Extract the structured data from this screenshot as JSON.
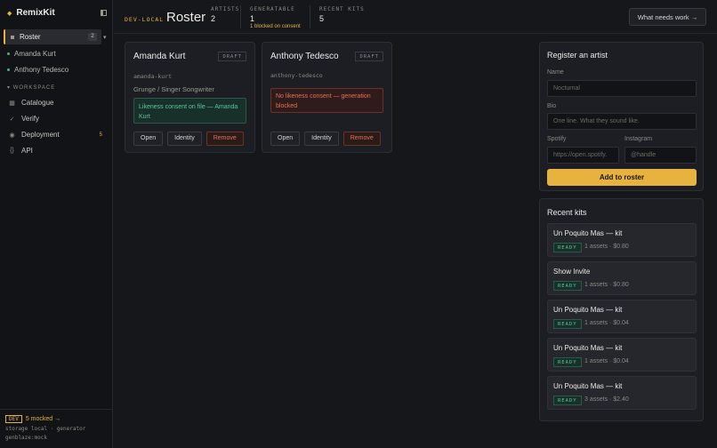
{
  "sidebar": {
    "brand": "RemixKit",
    "nav_roster": {
      "label": "Roster",
      "count": "2"
    },
    "artists": [
      "Amanda Kurt",
      "Anthony Tedesco"
    ],
    "workspace_title": "WORKSPACE",
    "workspace_items": [
      {
        "label": "Catalogue",
        "icon": "catalogue-icon",
        "badge": ""
      },
      {
        "label": "Verify",
        "icon": "check-icon",
        "badge": ""
      },
      {
        "label": "Deployment",
        "icon": "deploy-icon",
        "badge": "5"
      },
      {
        "label": "API",
        "icon": "braces-icon",
        "badge": ""
      }
    ],
    "footer": {
      "dev_badge": "DEV",
      "mocked": "5 mocked →",
      "storage": "storage local · generator",
      "gen": "genblaze:mock"
    }
  },
  "header": {
    "env": "DEV-LOCAL",
    "title": "Roster",
    "stats": [
      {
        "label": "ARTISTS",
        "value": "2",
        "note": ""
      },
      {
        "label": "GENERATABLE",
        "value": "1",
        "note": "1 blocked on consent"
      },
      {
        "label": "RECENT KITS",
        "value": "5",
        "note": ""
      }
    ],
    "work_button": "What needs work →"
  },
  "artists": [
    {
      "name": "Amanda Kurt",
      "status": "DRAFT",
      "slug": "amanda-kurt",
      "genre": "Grunge / Singer Songwriter",
      "consent": "Likeness consent on file — Amanda Kurt",
      "consent_ok": true
    },
    {
      "name": "Anthony Tedesco",
      "status": "DRAFT",
      "slug": "anthony-tedesco",
      "genre": "",
      "consent": "No likeness consent — generation blocked",
      "consent_ok": false
    }
  ],
  "card_actions": {
    "open": "Open",
    "identity": "Identity",
    "remove": "Remove"
  },
  "register": {
    "title": "Register an artist",
    "name_label": "Name",
    "name_placeholder": "Nocturnal",
    "bio_label": "Bio",
    "bio_placeholder": "One line. What they sound like.",
    "spotify_label": "Spotify",
    "spotify_placeholder": "https://open.spotify.",
    "instagram_label": "Instagram",
    "instagram_placeholder": "@handle",
    "submit": "Add to roster"
  },
  "recent_kits": {
    "title": "Recent kits",
    "items": [
      {
        "title": "Un Poquito Mas — kit",
        "status": "READY",
        "meta": "1 assets · $0.80"
      },
      {
        "title": "Show Invite",
        "status": "READY",
        "meta": "1 assets · $0.80"
      },
      {
        "title": "Un Poquito Mas — kit",
        "status": "READY",
        "meta": "1 assets · $0.04"
      },
      {
        "title": "Un Poquito Mas — kit",
        "status": "READY",
        "meta": "1 assets · $0.04"
      },
      {
        "title": "Un Poquito Mas — kit",
        "status": "READY",
        "meta": "3 assets · $2.40"
      }
    ]
  },
  "colors": {
    "accent": "#e8b23f",
    "ok": "#5fc49a",
    "danger": "#e2725a",
    "bg": "#16171b"
  }
}
